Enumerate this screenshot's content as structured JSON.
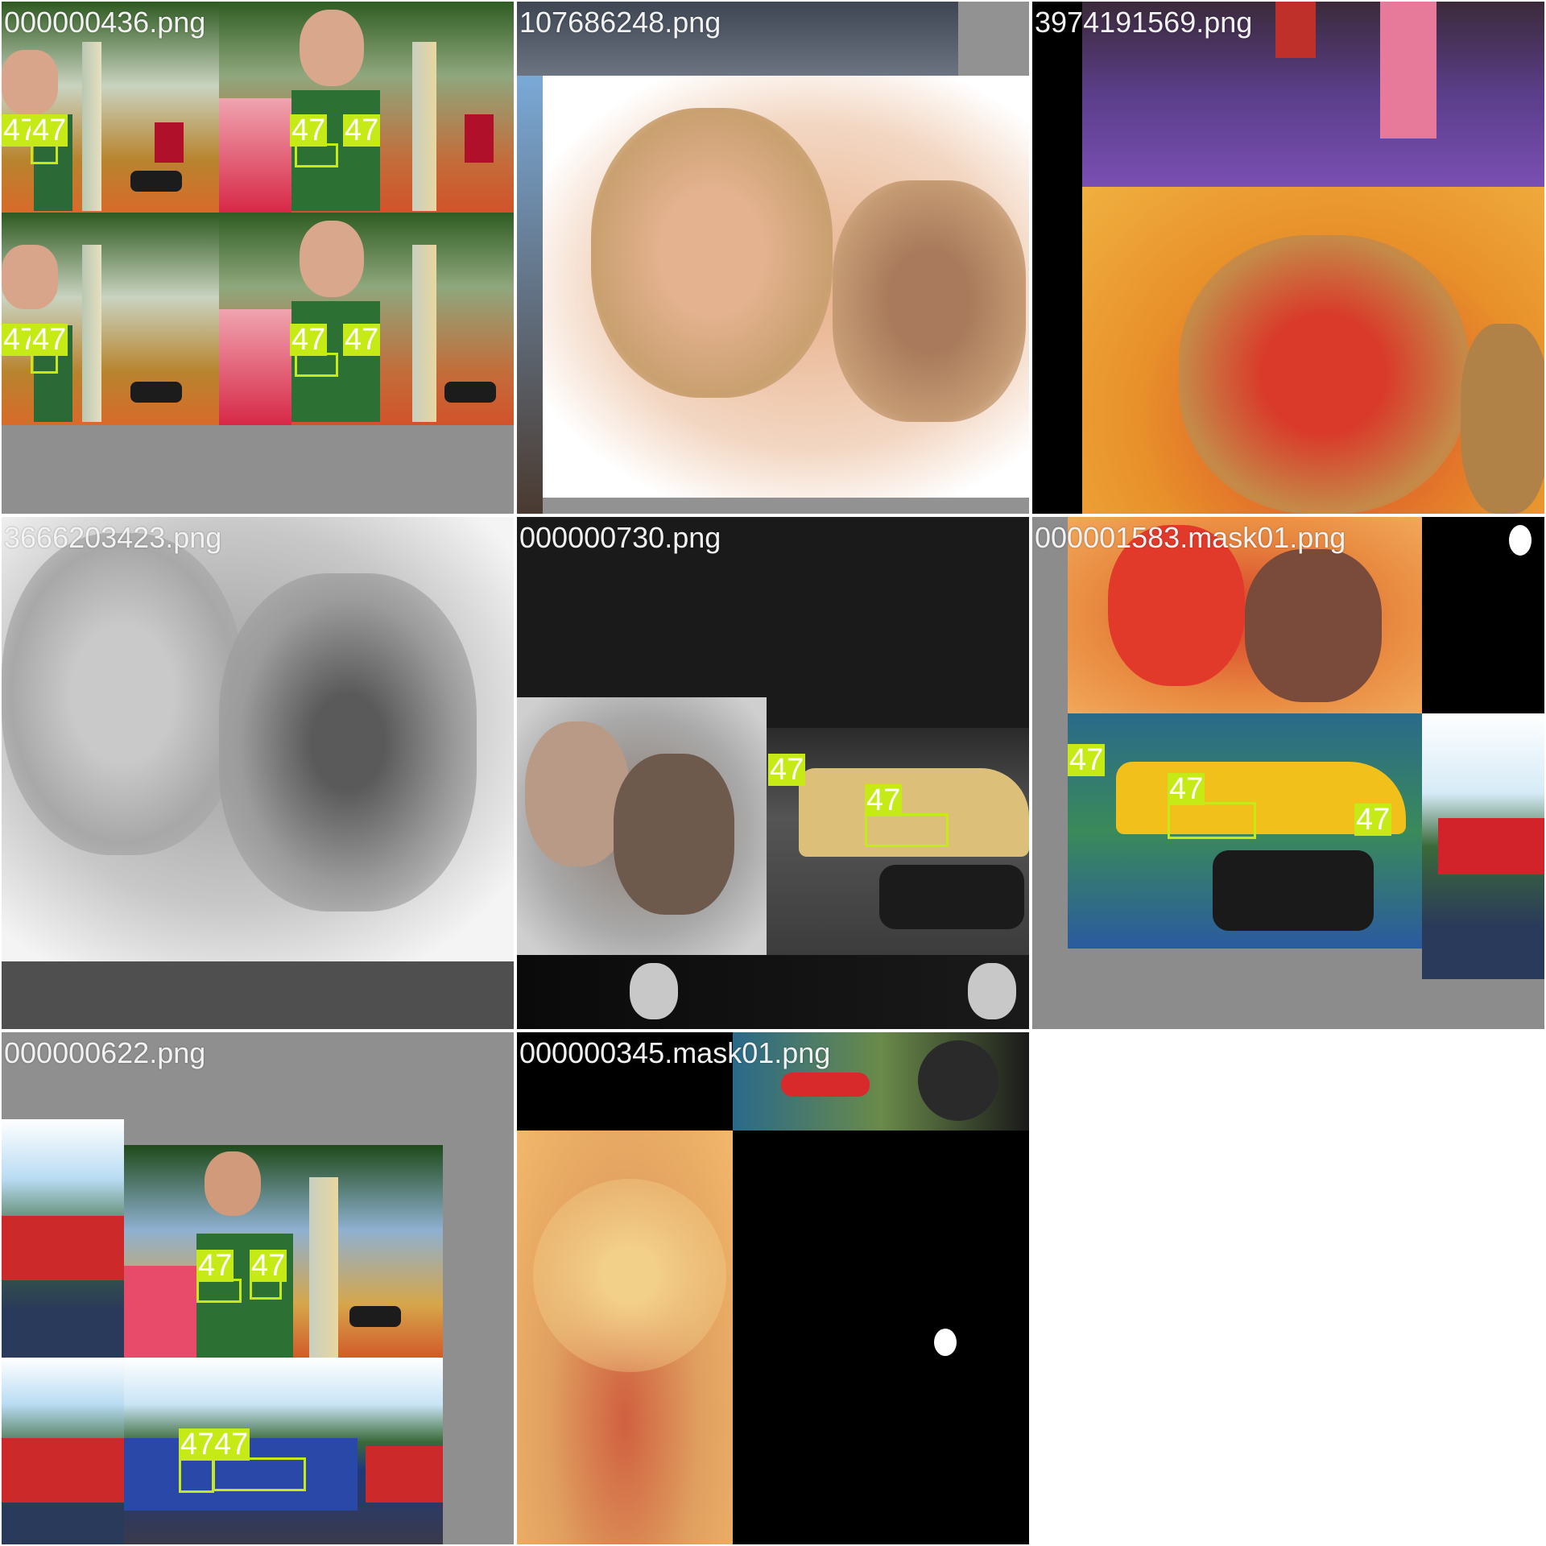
{
  "viewer": {
    "tiles": [
      {
        "filename": "000000436.png"
      },
      {
        "filename": "107686248.png"
      },
      {
        "filename": "3974191569.png"
      },
      {
        "filename": "3666203423.png"
      },
      {
        "filename": "000000730.png"
      },
      {
        "filename": "000001583.mask01.png"
      },
      {
        "filename": "000000622.png"
      },
      {
        "filename": "000000345.mask01.png"
      }
    ],
    "detection_label": "47",
    "detection_color": "#c6ea16",
    "icons": [
      "mask-blob-icon"
    ]
  }
}
